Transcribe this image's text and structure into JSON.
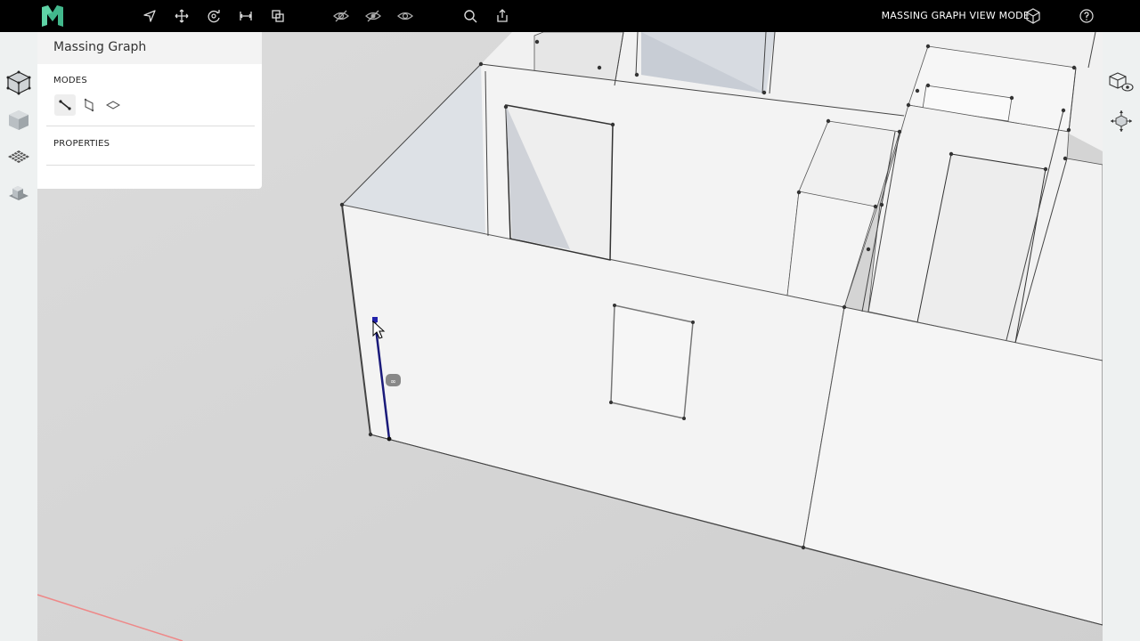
{
  "app": {
    "logo_icon": "massing-logo-icon",
    "accent_color": "#5fd3a6"
  },
  "toolbar": {
    "tools": [
      "select-arrow-icon",
      "move-icon",
      "orbit-icon",
      "dimension-icon",
      "copy-icon"
    ],
    "visibility_tools": [
      "hide-icon",
      "hide-selected-icon",
      "show-icon"
    ],
    "utility_tools": [
      "search-icon",
      "share-icon"
    ],
    "view_mode_label": "MASSING GRAPH VIEW MODE",
    "view_mode_icon": "cube-icon",
    "help_icon": "help-icon"
  },
  "left_rail": {
    "items": [
      "massing-graph-icon",
      "solid-box-icon",
      "grid-floor-icon",
      "building-icon"
    ]
  },
  "panel": {
    "title": "Massing Graph",
    "modes_label": "MODES",
    "modes": [
      "edge-mode-icon",
      "face-mode-icon",
      "plane-mode-icon"
    ],
    "properties_label": "PROPERTIES"
  },
  "right_rail": {
    "items": [
      "view-cube-eye-icon",
      "fit-view-icon"
    ]
  },
  "viewport": {
    "selection_color": "#1a1a7a"
  }
}
